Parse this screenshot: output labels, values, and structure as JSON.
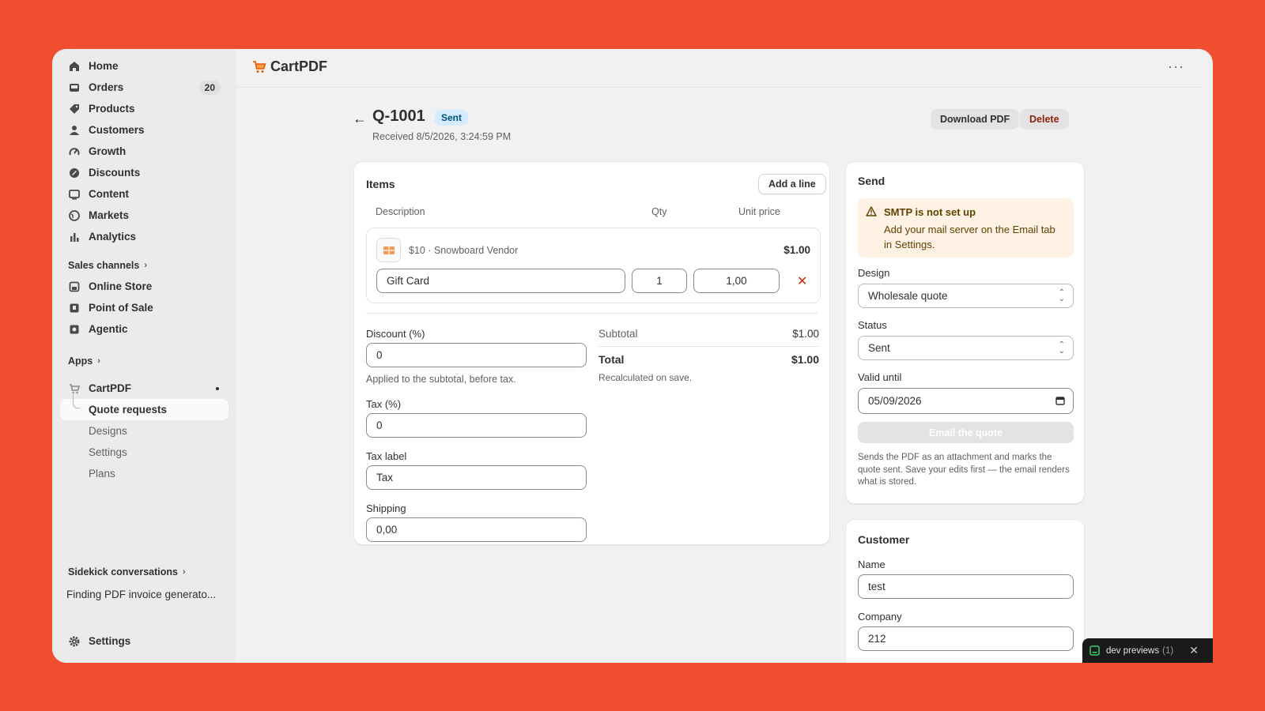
{
  "sidebar": {
    "nav": [
      {
        "label": "Home",
        "icon": "home-icon"
      },
      {
        "label": "Orders",
        "icon": "inbox-icon",
        "badge": "20"
      },
      {
        "label": "Products",
        "icon": "tag-icon"
      },
      {
        "label": "Customers",
        "icon": "person-icon"
      },
      {
        "label": "Growth",
        "icon": "gauge-icon"
      },
      {
        "label": "Discounts",
        "icon": "discount-icon"
      },
      {
        "label": "Content",
        "icon": "image-icon"
      },
      {
        "label": "Markets",
        "icon": "globe-icon"
      },
      {
        "label": "Analytics",
        "icon": "bar-chart-icon"
      }
    ],
    "sales_channels_label": "Sales channels",
    "channels": [
      {
        "label": "Online Store",
        "icon": "store-icon"
      },
      {
        "label": "Point of Sale",
        "icon": "pos-icon"
      },
      {
        "label": "Agentic",
        "icon": "agent-icon"
      }
    ],
    "apps_label": "Apps",
    "app_name": "CartPDF",
    "app_subitems": [
      "Quote requests",
      "Designs",
      "Settings",
      "Plans"
    ],
    "sidekick_label": "Sidekick conversations",
    "sidekick_item": "Finding PDF invoice generato...",
    "settings_label": "Settings"
  },
  "topbar": {
    "brand": "CartPDF",
    "more_icon": "more-horizontal-icon"
  },
  "header": {
    "quote_id": "Q-1001",
    "status": "Sent",
    "received": "Received 8/5/2026, 3:24:59 PM",
    "download_label": "Download PDF",
    "delete_label": "Delete"
  },
  "items": {
    "title": "Items",
    "add_line_label": "Add a line",
    "columns": {
      "description": "Description",
      "qty": "Qty",
      "unit_price": "Unit price"
    },
    "line": {
      "vendor": "$10 · Snowboard Vendor",
      "line_total": "$1.00",
      "description": "Gift Card",
      "qty": "1",
      "unit_price": "1,00"
    },
    "discount_label": "Discount (%)",
    "discount_value": "0",
    "discount_help": "Applied to the subtotal, before tax.",
    "tax_label": "Tax (%)",
    "tax_value": "0",
    "tax_name_label": "Tax label",
    "tax_name_value": "Tax",
    "shipping_label": "Shipping",
    "shipping_value": "0,00",
    "subtotal_label": "Subtotal",
    "subtotal_value": "$1.00",
    "total_label": "Total",
    "total_value": "$1.00",
    "recalc_note": "Recalculated on save."
  },
  "send": {
    "title": "Send",
    "banner_title": "SMTP is not set up",
    "banner_body": "Add your mail server on the Email tab in Settings.",
    "design_label": "Design",
    "design_value": "Wholesale quote",
    "status_label": "Status",
    "status_value": "Sent",
    "valid_label": "Valid until",
    "valid_value": "05/09/2026",
    "email_button": "Email the quote",
    "note": "Sends the PDF as an attachment and marks the quote sent. Save your edits first — the email renders what is stored."
  },
  "customer": {
    "title": "Customer",
    "name_label": "Name",
    "name_value": "test",
    "company_label": "Company",
    "company_value": "212"
  },
  "devbar": {
    "label": "dev previews",
    "count": "(1)"
  },
  "colors": {
    "background": "#ef4f2f",
    "status_pill": "#d5ebff",
    "banner": "#fff1e3",
    "delete_text": "#8e1f0b",
    "remove_icon": "#c5280c"
  }
}
